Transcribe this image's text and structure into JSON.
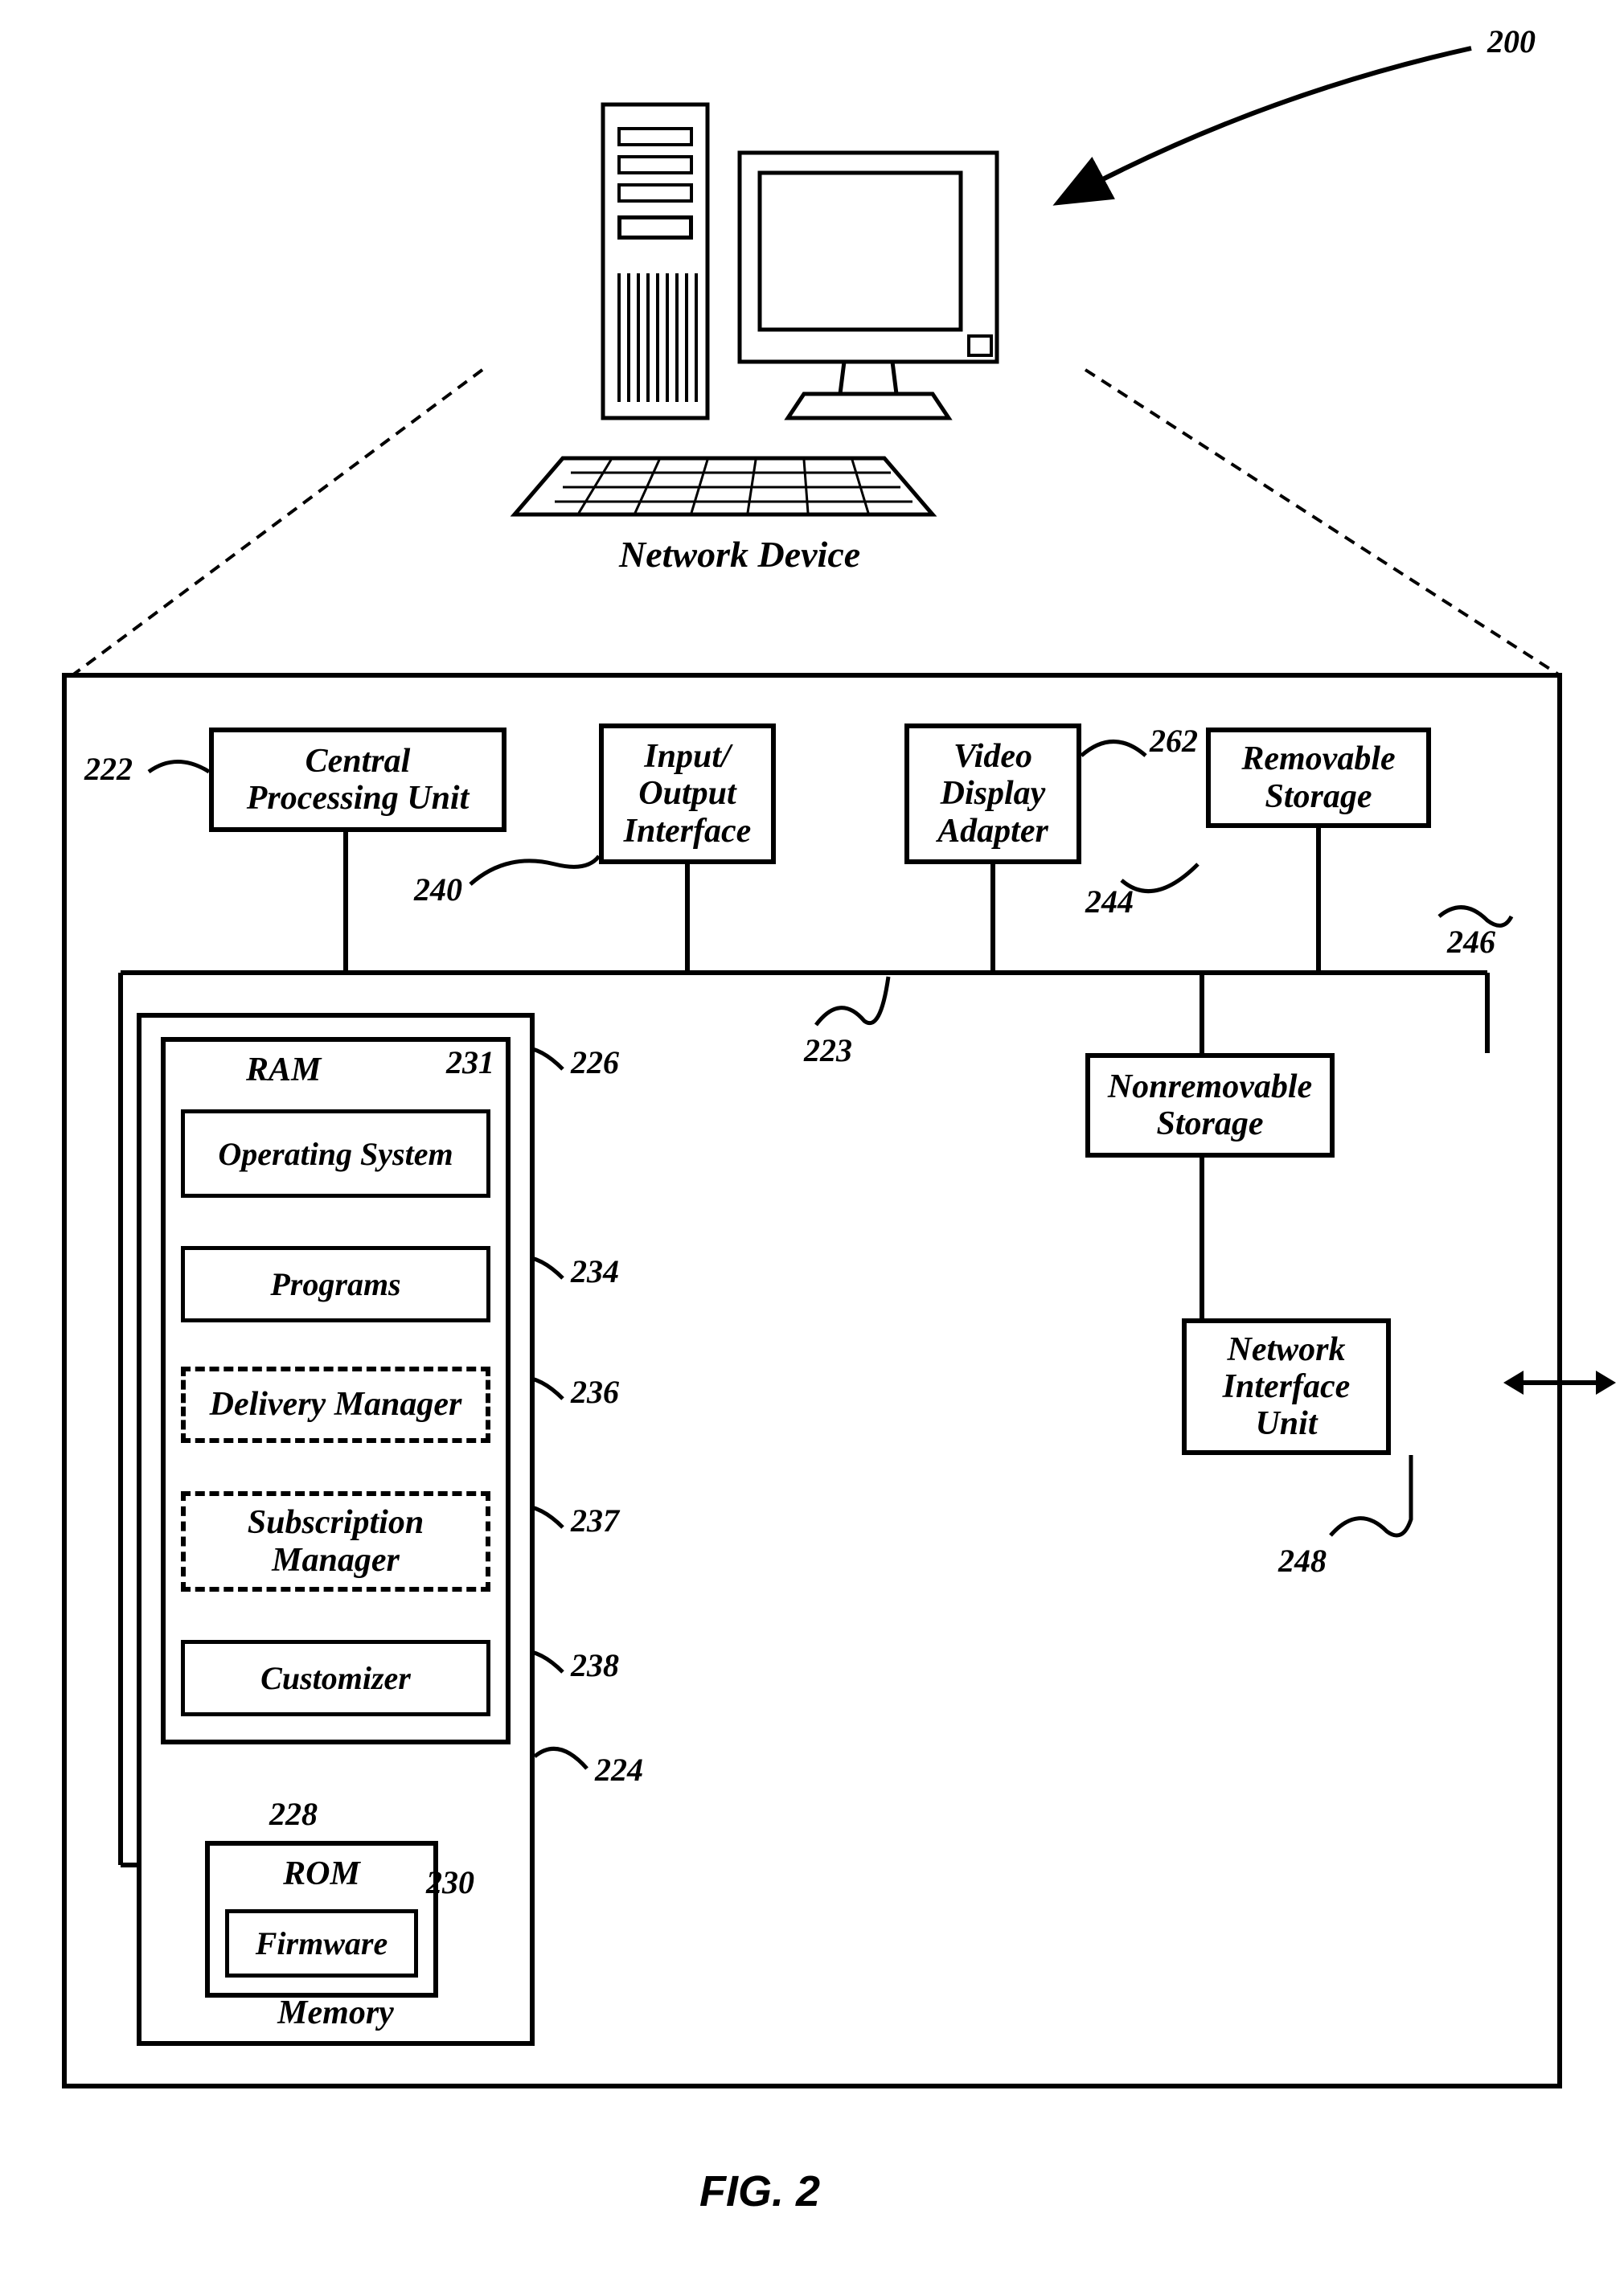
{
  "figureRef": "200",
  "networkDeviceLabel": "Network Device",
  "cpu": {
    "label": "Central\nProcessing Unit",
    "ref": "222"
  },
  "io": {
    "label": "Input/\nOutput\nInterface",
    "ref": "240"
  },
  "vda": {
    "label": "Video\nDisplay\nAdapter",
    "ref": "262"
  },
  "removable": {
    "label": "Removable\nStorage",
    "ref": "244"
  },
  "bus": {
    "ref": "223"
  },
  "nonremovable": {
    "label": "Nonremovable\nStorage",
    "ref": "246"
  },
  "niu": {
    "label": "Network\nInterface\nUnit",
    "ref": "248"
  },
  "memory": {
    "label": "Memory",
    "ref": "224"
  },
  "ram": {
    "label": "RAM",
    "ref": "226"
  },
  "os": {
    "label": "Operating System",
    "ref": "231"
  },
  "programs": {
    "label": "Programs",
    "ref": "234"
  },
  "delivery": {
    "label": "Delivery Manager",
    "ref": "236"
  },
  "subscription": {
    "label": "Subscription\nManager",
    "ref": "237"
  },
  "customizer": {
    "label": "Customizer",
    "ref": "238"
  },
  "rom": {
    "label": "ROM",
    "ref": "228"
  },
  "firmware": {
    "label": "Firmware",
    "ref": "230"
  },
  "figLabel": "FIG. 2"
}
